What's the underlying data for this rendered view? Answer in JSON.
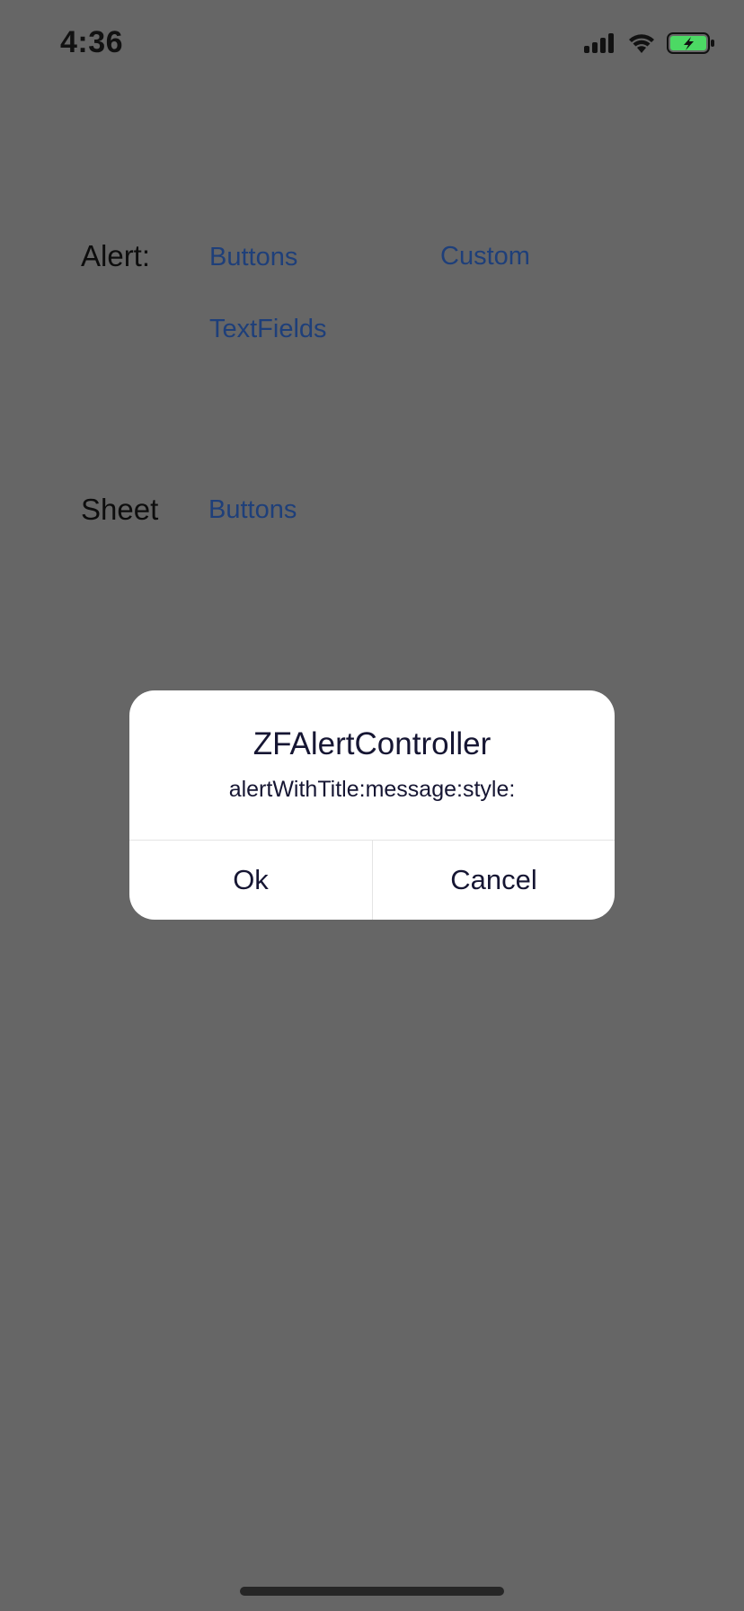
{
  "status_bar": {
    "time": "4:36",
    "icons": [
      "cellular-signal-icon",
      "wifi-icon",
      "battery-charging-icon"
    ],
    "battery_color": "#4cd964"
  },
  "alert_section": {
    "label": "Alert:",
    "buttons_link": "Buttons",
    "custom_link": "Custom",
    "textfields_link": "TextFields"
  },
  "sheet_section": {
    "label": "Sheet",
    "buttons_link": "Buttons"
  },
  "dialog": {
    "title": "ZFAlertController",
    "message": "alertWithTitle:message:style:",
    "ok_label": "Ok",
    "cancel_label": "Cancel"
  },
  "colors": {
    "dim_background": "#666666",
    "link": "#1e3f7a",
    "dialog_text": "#161633"
  }
}
